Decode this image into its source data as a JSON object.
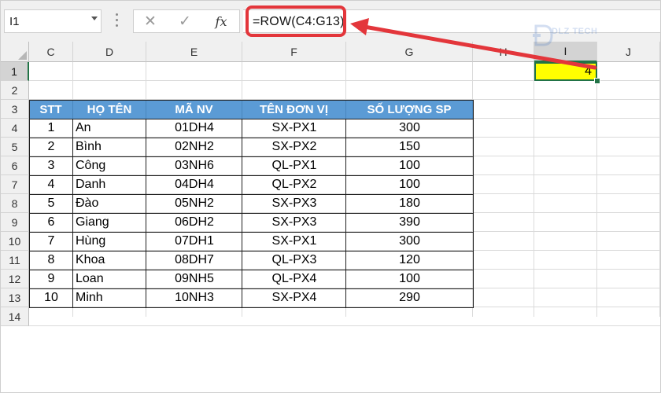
{
  "formula_bar": {
    "name_box": "I1",
    "cancel_icon": "x-icon",
    "enter_icon": "check-icon",
    "fx_label": "fx",
    "formula": "=ROW(C4:G13)"
  },
  "watermark": {
    "text": "DLZ TECH"
  },
  "columns": [
    "C",
    "D",
    "E",
    "F",
    "G",
    "H",
    "I",
    "J"
  ],
  "rows": [
    "1",
    "2",
    "3",
    "4",
    "5",
    "6",
    "7",
    "8",
    "9",
    "10",
    "11",
    "12",
    "13",
    "14"
  ],
  "selected_cell": {
    "value": "4"
  },
  "table": {
    "headers": [
      "STT",
      "HỌ TÊN",
      "MÃ NV",
      "TÊN ĐƠN VỊ",
      "SỐ LƯỢNG SP"
    ],
    "rows": [
      [
        "1",
        "An",
        "01DH4",
        "SX-PX1",
        "300"
      ],
      [
        "2",
        "Bình",
        "02NH2",
        "SX-PX2",
        "150"
      ],
      [
        "3",
        "Công",
        "03NH6",
        "QL-PX1",
        "100"
      ],
      [
        "4",
        "Danh",
        "04DH4",
        "QL-PX2",
        "100"
      ],
      [
        "5",
        "Đào",
        "05NH2",
        "SX-PX3",
        "180"
      ],
      [
        "6",
        "Giang",
        "06DH2",
        "SX-PX3",
        "390"
      ],
      [
        "7",
        "Hùng",
        "07DH1",
        "SX-PX1",
        "300"
      ],
      [
        "8",
        "Khoa",
        "08DH7",
        "QL-PX3",
        "120"
      ],
      [
        "9",
        "Loan",
        "09NH5",
        "QL-PX4",
        "100"
      ],
      [
        "10",
        "Minh",
        "10NH3",
        "SX-PX4",
        "290"
      ]
    ]
  },
  "colors": {
    "header_fill": "#5b9bd5",
    "highlight": "#ffff00",
    "annotation": "#e3363b",
    "selection": "#217346"
  }
}
